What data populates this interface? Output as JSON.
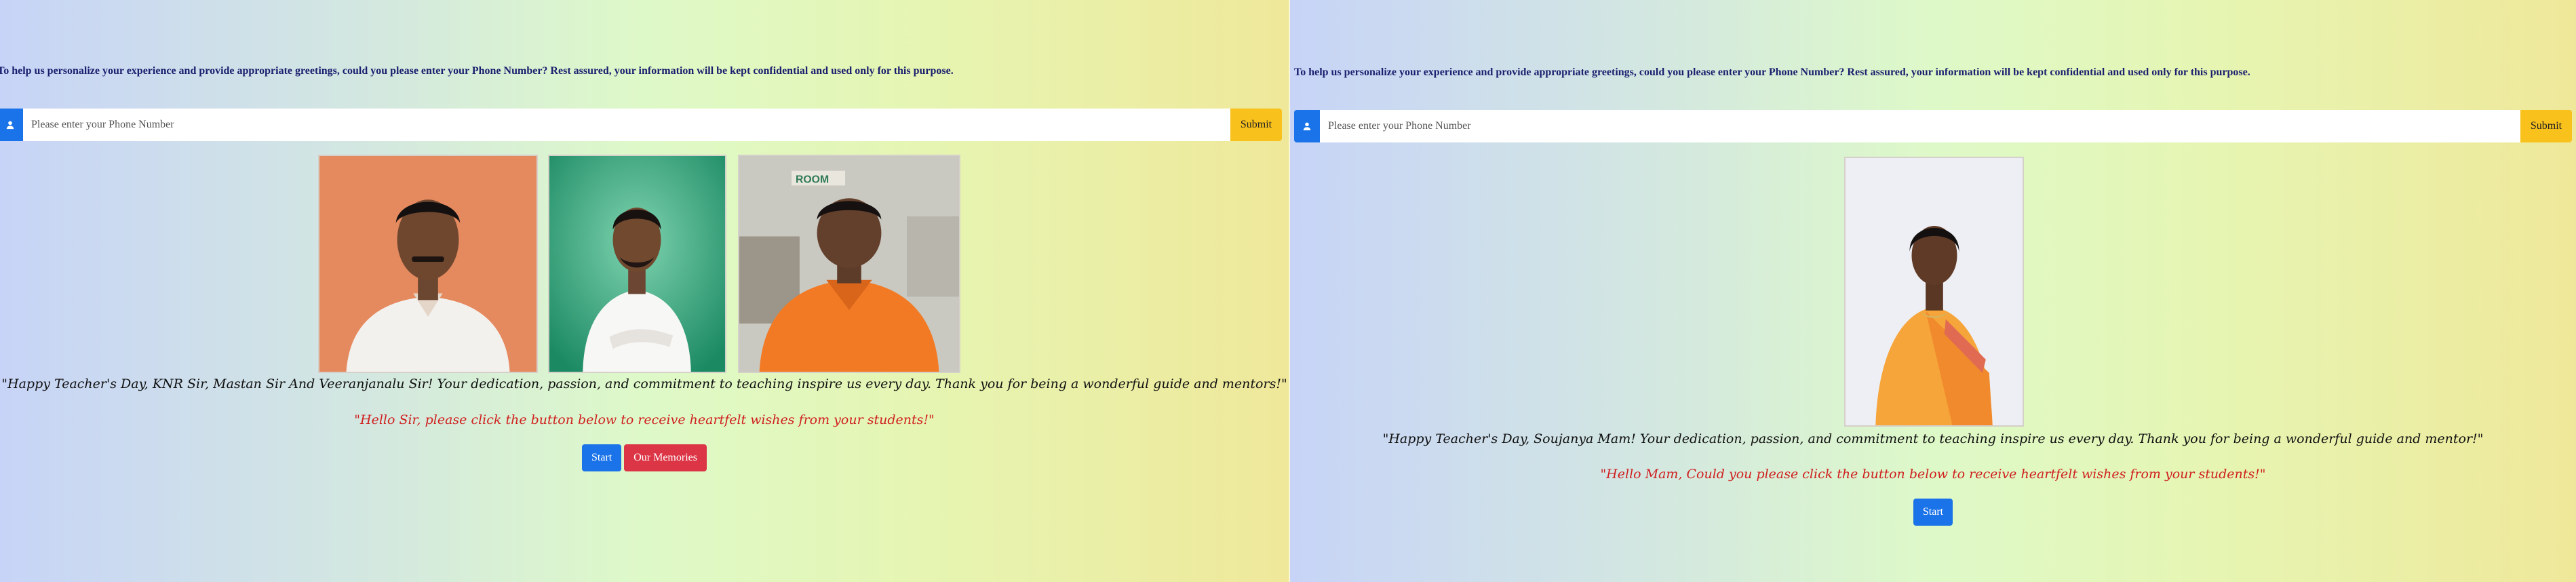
{
  "left_panel": {
    "intro": "To help us personalize your experience and provide appropriate greetings, could you please enter your Phone Number? Rest assured, your information will be kept confidential and used only for this purpose.",
    "phone_placeholder": "Please enter your Phone Number",
    "submit_label": "Submit",
    "greeting": "\"Happy Teacher's Day, KNR Sir, Mastan Sir And Veeranjanalu Sir! Your dedication, passion, and commitment to teaching inspire us every day. Thank you for being a wonderful guide and mentors!\"",
    "prompt": "\"Hello Sir, please click the button below to receive heartfelt wishes from your students!\"",
    "start_label": "Start",
    "memories_label": "Our Memories"
  },
  "right_panel": {
    "intro": "To help us personalize your experience and provide appropriate greetings, could you please enter your Phone Number? Rest assured, your information will be kept confidential and used only for this purpose.",
    "phone_placeholder": "Please enter your Phone Number",
    "submit_label": "Submit",
    "greeting": "\"Happy Teacher's Day, Soujanya Mam! Your dedication, passion, and commitment to teaching inspire us every day. Thank you for being a wonderful guide and mentor!\"",
    "prompt": "\"Hello Mam, Could you please click the button below to receive heartfelt wishes from your students!\"",
    "start_label": "Start"
  },
  "icons": {
    "input_addon": "user-icon"
  },
  "colors": {
    "primary_blue": "#1a73e8",
    "submit_yellow": "#f8c11c",
    "danger_red": "#dc3545",
    "intro_text": "#1b1f6e",
    "prompt_text": "#d01f1f"
  }
}
